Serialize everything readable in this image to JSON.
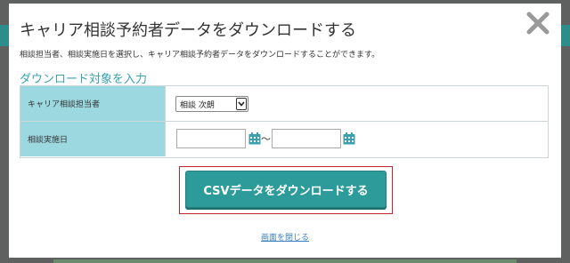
{
  "modal": {
    "title": "キャリア相談予約者データをダウンロードする",
    "description": "相談担当者、相談実施日を選択し、キャリア相談予約者データをダウンロードすることができます。",
    "section_heading": "ダウンロード対象を入力",
    "close_icon": "close-x-icon"
  },
  "form": {
    "rows": [
      {
        "label": "キャリア相談担当者",
        "select_value": "相談 次朗"
      },
      {
        "label": "相談実施日",
        "date_from": "",
        "date_to": "",
        "separator": "〜"
      }
    ],
    "calendar_icon": "calendar-icon"
  },
  "actions": {
    "download_button": "CSVデータをダウンロードする",
    "close_link": "画面を閉じる"
  },
  "colors": {
    "accent": "#2e9b9b",
    "label_bg": "#9bd8e0",
    "heading": "#3aa0b0",
    "highlight_border": "#c0272d",
    "link": "#3a7fc0"
  }
}
